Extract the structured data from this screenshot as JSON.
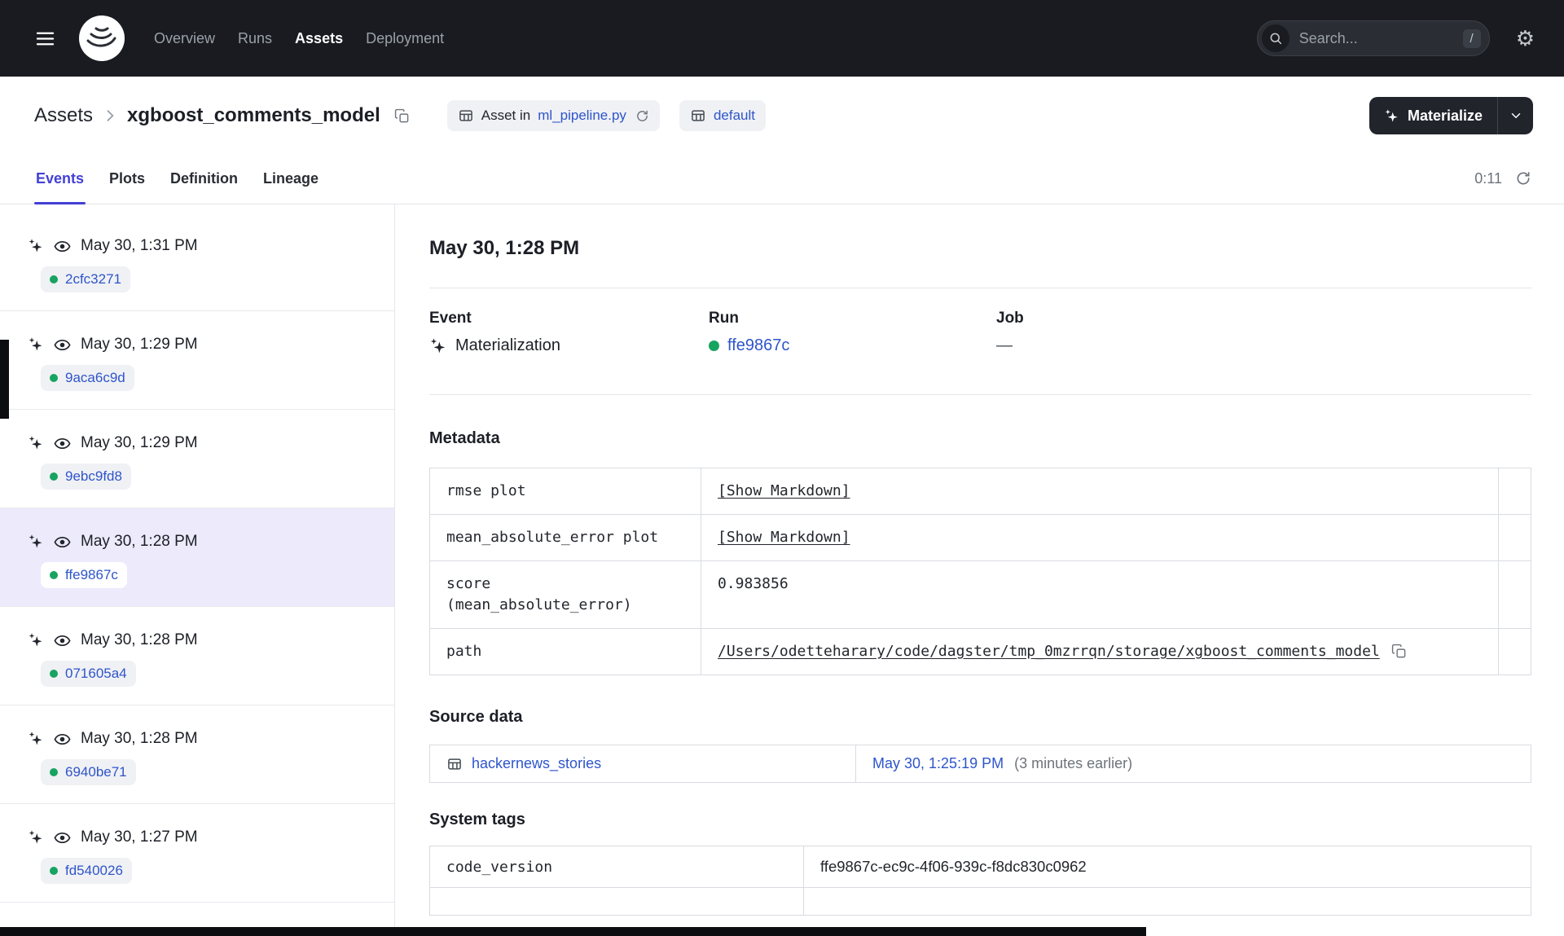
{
  "colors": {
    "accent": "#4440d4",
    "link": "#2e55cb",
    "success_green": "#17a360",
    "topbar_bg": "#191b20",
    "selected_event_bg": "#eceafb"
  },
  "header": {
    "nav": [
      {
        "label": "Overview"
      },
      {
        "label": "Runs"
      },
      {
        "label": "Assets",
        "active": true
      },
      {
        "label": "Deployment"
      }
    ],
    "search": {
      "placeholder": "Search...",
      "shortcut": "/"
    }
  },
  "breadcrumb": {
    "root": "Assets",
    "current": "xgboost_comments_model"
  },
  "chips": {
    "asset_in": {
      "prefix": "Asset in",
      "file": "ml_pipeline.py"
    },
    "group": {
      "label": "default"
    }
  },
  "materialize": {
    "label": "Materialize"
  },
  "tabs": [
    {
      "label": "Events",
      "active": true
    },
    {
      "label": "Plots"
    },
    {
      "label": "Definition"
    },
    {
      "label": "Lineage"
    }
  ],
  "auto_refresh": {
    "countdown": "0:11"
  },
  "sidebar": {
    "events": [
      {
        "icon": "materialization",
        "time": "May 30, 1:31 PM",
        "run_id": "2cfc3271"
      },
      {
        "icon": "observation",
        "time": "May 30, 1:29 PM",
        "run_id": "9aca6c9d"
      },
      {
        "icon": "observation",
        "time": "May 30, 1:29 PM",
        "run_id": "9ebc9fd8"
      },
      {
        "icon": "materialization",
        "time": "May 30, 1:28 PM",
        "run_id": "ffe9867c",
        "selected": true
      },
      {
        "icon": "materialization",
        "time": "May 30, 1:28 PM",
        "run_id": "071605a4"
      },
      {
        "icon": "materialization",
        "time": "May 30, 1:28 PM",
        "run_id": "6940be71"
      },
      {
        "icon": "observation",
        "time": "May 30, 1:27 PM",
        "run_id": "fd540026"
      }
    ]
  },
  "detail": {
    "title": "May 30, 1:28 PM",
    "event": {
      "label": "Event",
      "value": "Materialization"
    },
    "run": {
      "label": "Run",
      "value": "ffe9867c"
    },
    "job": {
      "label": "Job",
      "value": "—"
    },
    "metadata": {
      "heading": "Metadata",
      "rows": [
        {
          "key": "rmse plot",
          "value": "[Show Markdown]",
          "type": "link"
        },
        {
          "key": "mean_absolute_error plot",
          "value": "[Show Markdown]",
          "type": "link"
        },
        {
          "key": "score\n(mean_absolute_error)",
          "value": "0.983856",
          "type": "text"
        },
        {
          "key": "path",
          "value": "/Users/odetteharary/code/dagster/tmp_0mzrrqn/storage/xgboost_comments_model",
          "type": "path"
        }
      ]
    },
    "source_data": {
      "heading": "Source data",
      "asset": "hackernews_stories",
      "timestamp": "May 30, 1:25:19 PM",
      "relative": "(3 minutes earlier)"
    },
    "system_tags": {
      "heading": "System tags",
      "rows": [
        {
          "key": "code_version",
          "value": "ffe9867c-ec9c-4f06-939c-f8dc830c0962"
        }
      ]
    }
  }
}
